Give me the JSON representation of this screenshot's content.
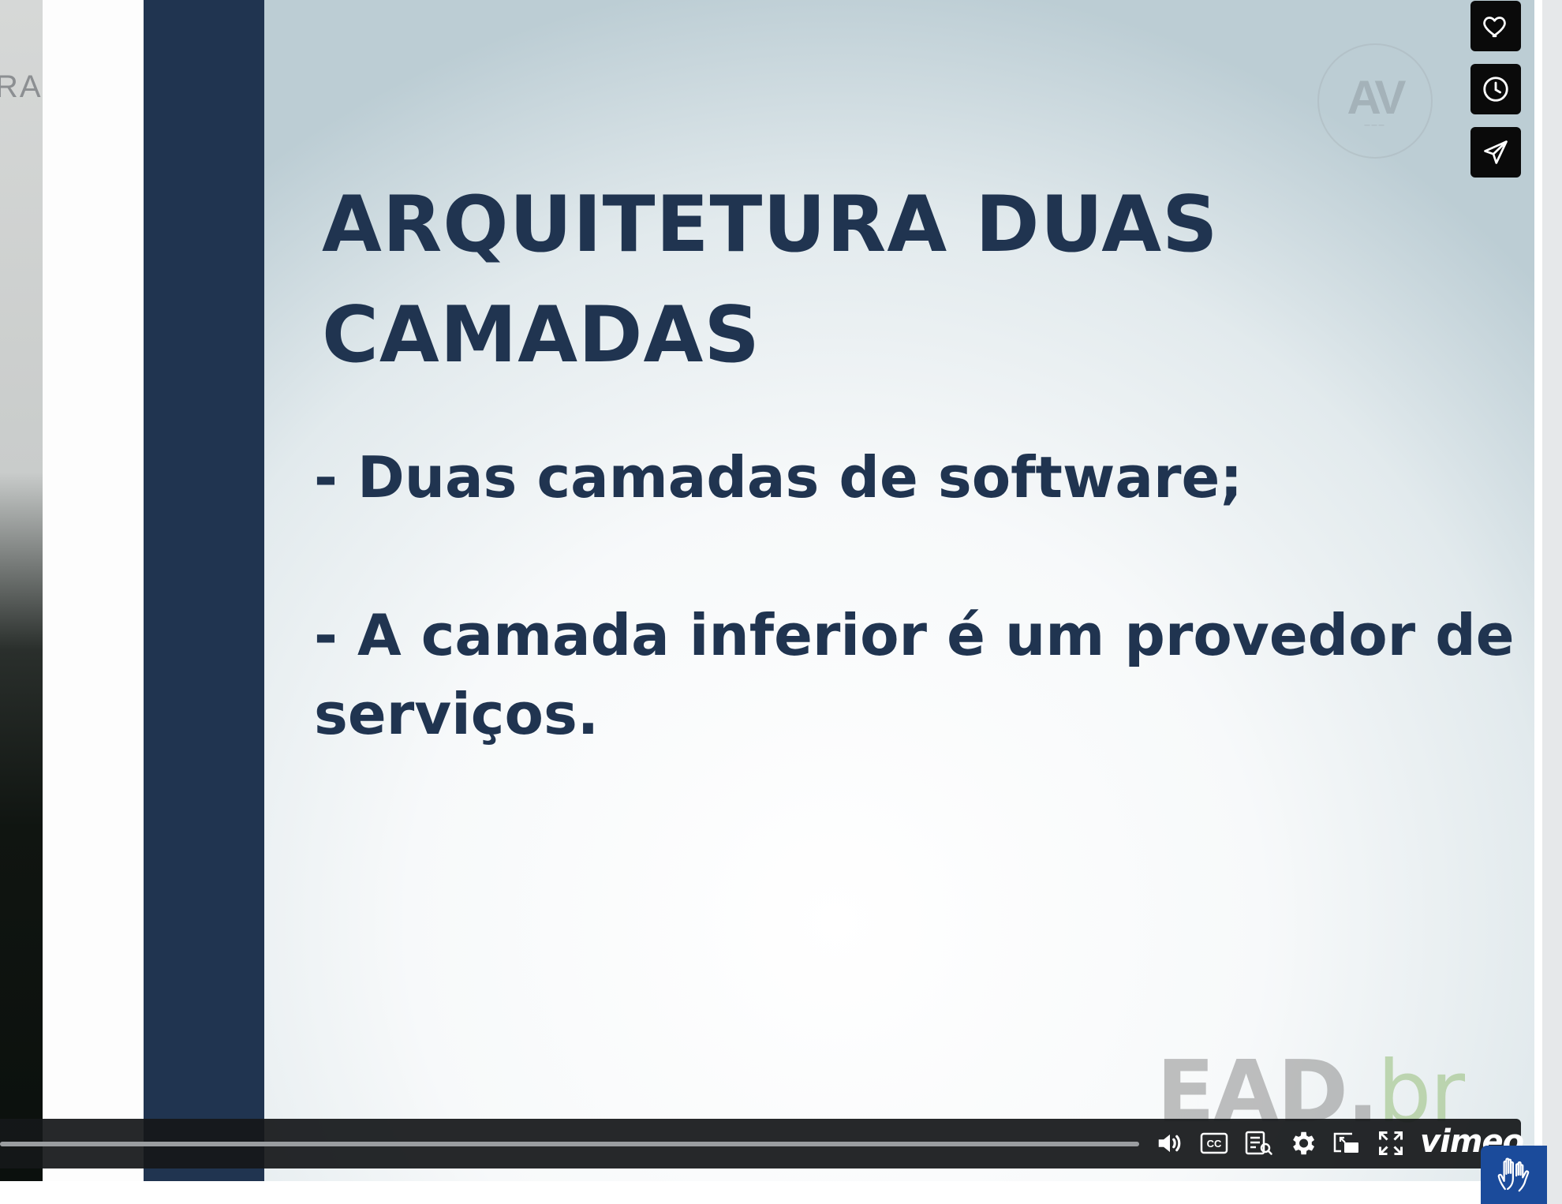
{
  "presenter": {
    "label_fragment": "RAL"
  },
  "slide": {
    "title_line_1": "ARQUITETURA DUAS",
    "title_line_2": "CAMADAS",
    "bullet_1": "- Duas camadas de software;",
    "bullet_2_line_1": "- A camada inferior é um provedor de",
    "bullet_2_line_2": "serviços.",
    "logo_av": "AV",
    "logo_ead": "EAD.",
    "logo_br": "br"
  },
  "side_actions": {
    "like_icon": "heart-icon",
    "watch_later_icon": "clock-icon",
    "share_icon": "paper-plane-icon"
  },
  "player": {
    "progress_fraction": 1.0,
    "volume_icon": "speaker-icon",
    "captions_label": "CC",
    "transcript_icon": "transcript-icon",
    "settings_icon": "gear-icon",
    "pip_icon": "picture-in-picture-icon",
    "fullscreen_icon": "fullscreen-icon",
    "brand": "vimeo"
  },
  "accessibility": {
    "icon": "sign-language-hands-icon"
  },
  "colors": {
    "slide_navy": "#203450",
    "control_bar": "#16181a",
    "accessibility_blue": "#1b4b9b"
  }
}
